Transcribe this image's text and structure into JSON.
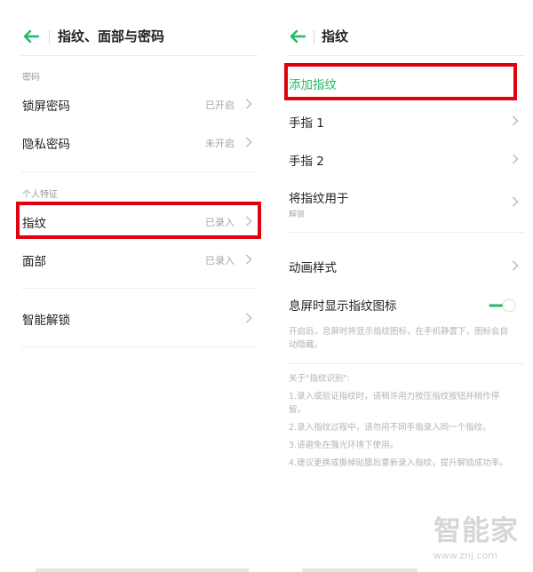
{
  "left": {
    "title": "指纹、面部与密码",
    "section_password": "密码",
    "lock_screen": {
      "label": "锁屏密码",
      "value": "已开启"
    },
    "privacy": {
      "label": "隐私密码",
      "value": "未开启"
    },
    "section_personal": "个人特征",
    "fingerprint": {
      "label": "指纹",
      "value": "已录入"
    },
    "face": {
      "label": "面部",
      "value": "已录入"
    },
    "smart_unlock": {
      "label": "智能解锁"
    }
  },
  "right": {
    "title": "指纹",
    "add_fingerprint": "添加指纹",
    "finger1": "手指 1",
    "finger2": "手指 2",
    "use_for": {
      "label": "将指纹用于",
      "sub": "解锁"
    },
    "animation": "动画样式",
    "screen_off_icon": {
      "label": "息屏时显示指纹图标",
      "toggle_on": true
    },
    "screen_off_desc_line1": "开启后，息屏时将显示指纹图标，在手机静置下，图标会自",
    "screen_off_desc_line2": "动隐藏。",
    "about_title": "关于\"指纹识别\":",
    "tip1_line1": "1.录入或验证指纹时，请稍许用力按压指纹按钮并稍作停",
    "tip1_line2": "留。",
    "tip2": "2.录入指纹过程中，请勿用不同手指录入同一个指纹。",
    "tip3": "3.请避免在强光环境下使用。",
    "tip4": "4.建议更换或撕掉贴膜后重新录入指纹，提升解锁成功率。"
  },
  "watermark": {
    "brand": "智能家",
    "url": "www.znj.com"
  },
  "colors": {
    "accent": "#1fbb67",
    "highlight": "#e0000f"
  }
}
